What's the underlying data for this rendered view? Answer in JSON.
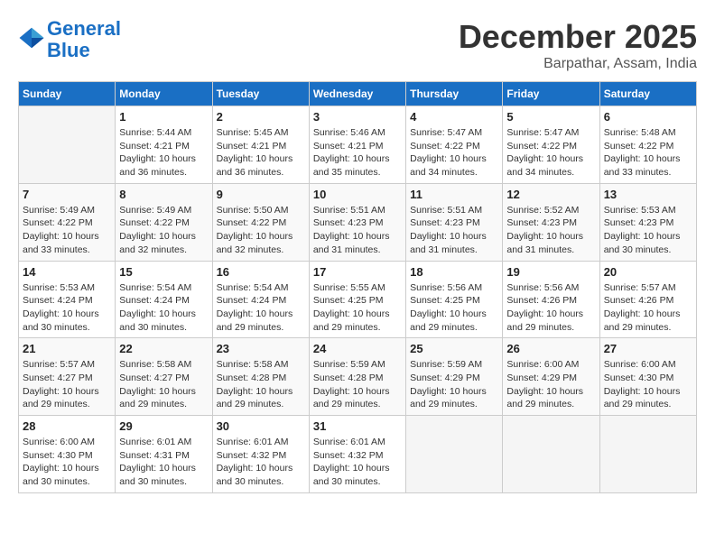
{
  "header": {
    "logo_line1": "General",
    "logo_line2": "Blue",
    "month": "December 2025",
    "location": "Barpathar, Assam, India"
  },
  "days_of_week": [
    "Sunday",
    "Monday",
    "Tuesday",
    "Wednesday",
    "Thursday",
    "Friday",
    "Saturday"
  ],
  "weeks": [
    [
      {
        "day": "",
        "info": ""
      },
      {
        "day": "1",
        "info": "Sunrise: 5:44 AM\nSunset: 4:21 PM\nDaylight: 10 hours\nand 36 minutes."
      },
      {
        "day": "2",
        "info": "Sunrise: 5:45 AM\nSunset: 4:21 PM\nDaylight: 10 hours\nand 36 minutes."
      },
      {
        "day": "3",
        "info": "Sunrise: 5:46 AM\nSunset: 4:21 PM\nDaylight: 10 hours\nand 35 minutes."
      },
      {
        "day": "4",
        "info": "Sunrise: 5:47 AM\nSunset: 4:22 PM\nDaylight: 10 hours\nand 34 minutes."
      },
      {
        "day": "5",
        "info": "Sunrise: 5:47 AM\nSunset: 4:22 PM\nDaylight: 10 hours\nand 34 minutes."
      },
      {
        "day": "6",
        "info": "Sunrise: 5:48 AM\nSunset: 4:22 PM\nDaylight: 10 hours\nand 33 minutes."
      }
    ],
    [
      {
        "day": "7",
        "info": "Sunrise: 5:49 AM\nSunset: 4:22 PM\nDaylight: 10 hours\nand 33 minutes."
      },
      {
        "day": "8",
        "info": "Sunrise: 5:49 AM\nSunset: 4:22 PM\nDaylight: 10 hours\nand 32 minutes."
      },
      {
        "day": "9",
        "info": "Sunrise: 5:50 AM\nSunset: 4:22 PM\nDaylight: 10 hours\nand 32 minutes."
      },
      {
        "day": "10",
        "info": "Sunrise: 5:51 AM\nSunset: 4:23 PM\nDaylight: 10 hours\nand 31 minutes."
      },
      {
        "day": "11",
        "info": "Sunrise: 5:51 AM\nSunset: 4:23 PM\nDaylight: 10 hours\nand 31 minutes."
      },
      {
        "day": "12",
        "info": "Sunrise: 5:52 AM\nSunset: 4:23 PM\nDaylight: 10 hours\nand 31 minutes."
      },
      {
        "day": "13",
        "info": "Sunrise: 5:53 AM\nSunset: 4:23 PM\nDaylight: 10 hours\nand 30 minutes."
      }
    ],
    [
      {
        "day": "14",
        "info": "Sunrise: 5:53 AM\nSunset: 4:24 PM\nDaylight: 10 hours\nand 30 minutes."
      },
      {
        "day": "15",
        "info": "Sunrise: 5:54 AM\nSunset: 4:24 PM\nDaylight: 10 hours\nand 30 minutes."
      },
      {
        "day": "16",
        "info": "Sunrise: 5:54 AM\nSunset: 4:24 PM\nDaylight: 10 hours\nand 29 minutes."
      },
      {
        "day": "17",
        "info": "Sunrise: 5:55 AM\nSunset: 4:25 PM\nDaylight: 10 hours\nand 29 minutes."
      },
      {
        "day": "18",
        "info": "Sunrise: 5:56 AM\nSunset: 4:25 PM\nDaylight: 10 hours\nand 29 minutes."
      },
      {
        "day": "19",
        "info": "Sunrise: 5:56 AM\nSunset: 4:26 PM\nDaylight: 10 hours\nand 29 minutes."
      },
      {
        "day": "20",
        "info": "Sunrise: 5:57 AM\nSunset: 4:26 PM\nDaylight: 10 hours\nand 29 minutes."
      }
    ],
    [
      {
        "day": "21",
        "info": "Sunrise: 5:57 AM\nSunset: 4:27 PM\nDaylight: 10 hours\nand 29 minutes."
      },
      {
        "day": "22",
        "info": "Sunrise: 5:58 AM\nSunset: 4:27 PM\nDaylight: 10 hours\nand 29 minutes."
      },
      {
        "day": "23",
        "info": "Sunrise: 5:58 AM\nSunset: 4:28 PM\nDaylight: 10 hours\nand 29 minutes."
      },
      {
        "day": "24",
        "info": "Sunrise: 5:59 AM\nSunset: 4:28 PM\nDaylight: 10 hours\nand 29 minutes."
      },
      {
        "day": "25",
        "info": "Sunrise: 5:59 AM\nSunset: 4:29 PM\nDaylight: 10 hours\nand 29 minutes."
      },
      {
        "day": "26",
        "info": "Sunrise: 6:00 AM\nSunset: 4:29 PM\nDaylight: 10 hours\nand 29 minutes."
      },
      {
        "day": "27",
        "info": "Sunrise: 6:00 AM\nSunset: 4:30 PM\nDaylight: 10 hours\nand 29 minutes."
      }
    ],
    [
      {
        "day": "28",
        "info": "Sunrise: 6:00 AM\nSunset: 4:30 PM\nDaylight: 10 hours\nand 30 minutes."
      },
      {
        "day": "29",
        "info": "Sunrise: 6:01 AM\nSunset: 4:31 PM\nDaylight: 10 hours\nand 30 minutes."
      },
      {
        "day": "30",
        "info": "Sunrise: 6:01 AM\nSunset: 4:32 PM\nDaylight: 10 hours\nand 30 minutes."
      },
      {
        "day": "31",
        "info": "Sunrise: 6:01 AM\nSunset: 4:32 PM\nDaylight: 10 hours\nand 30 minutes."
      },
      {
        "day": "",
        "info": ""
      },
      {
        "day": "",
        "info": ""
      },
      {
        "day": "",
        "info": ""
      }
    ]
  ]
}
